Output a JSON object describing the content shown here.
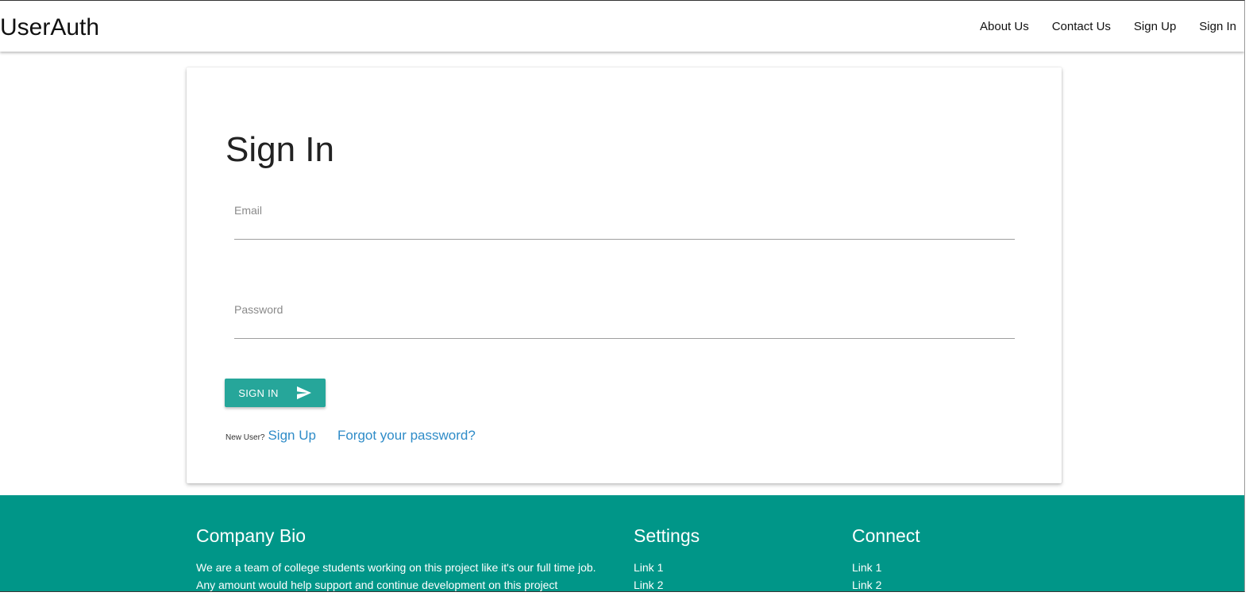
{
  "navbar": {
    "brand": "UserAuth",
    "links": [
      "About Us",
      "Contact Us",
      "Sign Up",
      "Sign In"
    ]
  },
  "signin_card": {
    "title": "Sign In",
    "email_label": "Email",
    "password_label": "Password",
    "submit_label": "SIGN IN",
    "submit_icon": "send-icon",
    "new_user_text": "New User?",
    "signup_link": "Sign Up",
    "forgot_link": "Forgot your password?"
  },
  "footer": {
    "bio_heading": "Company Bio",
    "bio_text": "We are a team of college students working on this project like it's our full time job. Any amount would help support and continue development on this project",
    "settings_heading": "Settings",
    "settings_links": [
      "Link 1",
      "Link 2"
    ],
    "connect_heading": "Connect",
    "connect_links": [
      "Link 1",
      "Link 2"
    ]
  },
  "colors": {
    "primary": "#26a69a",
    "footer_bg": "#009688",
    "link": "#2f8cc8"
  }
}
